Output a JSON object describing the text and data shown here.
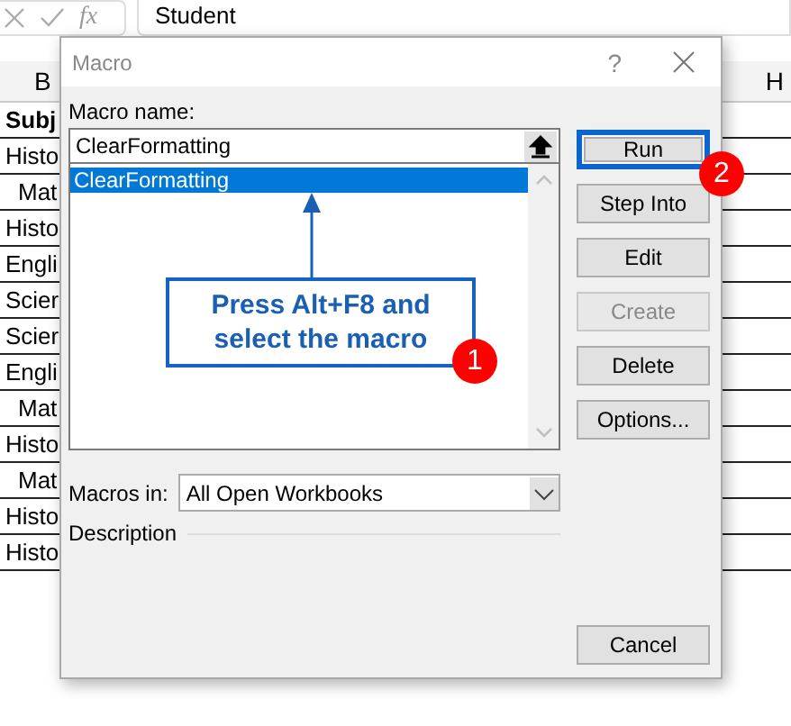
{
  "formula_bar": {
    "fx": "fx",
    "value": "Student"
  },
  "sheet": {
    "columns": [
      "B",
      "H"
    ],
    "rows": [
      {
        "text": "Subj",
        "header": true,
        "centered": false
      },
      {
        "text": "Histo",
        "header": false,
        "centered": false
      },
      {
        "text": "Mat",
        "header": false,
        "centered": true
      },
      {
        "text": "Histo",
        "header": false,
        "centered": false
      },
      {
        "text": "Engli",
        "header": false,
        "centered": false
      },
      {
        "text": "Scier",
        "header": false,
        "centered": false
      },
      {
        "text": "Scier",
        "header": false,
        "centered": false
      },
      {
        "text": "Engli",
        "header": false,
        "centered": false
      },
      {
        "text": "Mat",
        "header": false,
        "centered": true
      },
      {
        "text": "Histo",
        "header": false,
        "centered": false
      },
      {
        "text": "Mat",
        "header": false,
        "centered": true
      },
      {
        "text": "Histo",
        "header": false,
        "centered": false
      },
      {
        "text": "Histo",
        "header": false,
        "centered": false
      }
    ]
  },
  "dialog": {
    "title": "Macro",
    "help": "?",
    "name_label": "Macro name:",
    "name_value": "ClearFormatting",
    "macros": [
      {
        "name": "ClearFormatting",
        "selected": true
      }
    ],
    "buttons": [
      {
        "label": "Run",
        "focused": true,
        "disabled": false
      },
      {
        "label": "Step Into",
        "focused": false,
        "disabled": false
      },
      {
        "label": "Edit",
        "focused": false,
        "disabled": false
      },
      {
        "label": "Create",
        "focused": false,
        "disabled": true
      },
      {
        "label": "Delete",
        "focused": false,
        "disabled": false
      },
      {
        "label": "Options...",
        "focused": false,
        "disabled": false
      }
    ],
    "cancel": "Cancel",
    "macros_in_label": "Macros in:",
    "macros_in_value": "All Open Workbooks",
    "description_label": "Description"
  },
  "annotations": {
    "callout": "Press Alt+F8 and select the macro",
    "badges": [
      "1",
      "2"
    ]
  }
}
